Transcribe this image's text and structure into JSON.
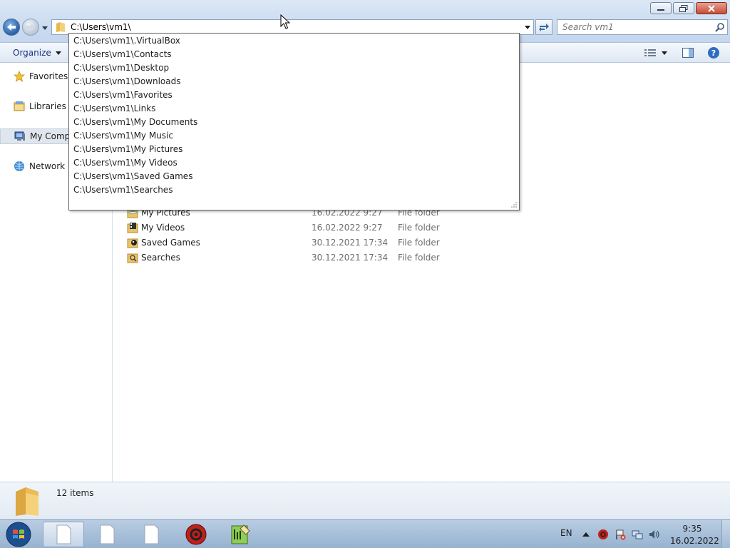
{
  "window": {
    "address": "C:\\Users\\vm1\\",
    "search_placeholder": "Search vm1"
  },
  "toolbar": {
    "organize_label": "Organize"
  },
  "navpane": {
    "items": [
      {
        "label": "Favorites",
        "icon": "star-icon"
      },
      {
        "label": "Libraries",
        "icon": "library-icon"
      },
      {
        "label": "My Computer",
        "icon": "computer-icon"
      },
      {
        "label": "Network",
        "icon": "network-icon"
      }
    ]
  },
  "autocomplete": {
    "items": [
      "C:\\Users\\vm1\\.VirtualBox",
      "C:\\Users\\vm1\\Contacts",
      "C:\\Users\\vm1\\Desktop",
      "C:\\Users\\vm1\\Downloads",
      "C:\\Users\\vm1\\Favorites",
      "C:\\Users\\vm1\\Links",
      "C:\\Users\\vm1\\My Documents",
      "C:\\Users\\vm1\\My Music",
      "C:\\Users\\vm1\\My Pictures",
      "C:\\Users\\vm1\\My Videos",
      "C:\\Users\\vm1\\Saved Games",
      "C:\\Users\\vm1\\Searches"
    ]
  },
  "files": [
    {
      "name": "My Pictures",
      "date": "16.02.2022 9:27",
      "type": "File folder",
      "icon": "pictures-folder-icon"
    },
    {
      "name": "My Videos",
      "date": "16.02.2022 9:27",
      "type": "File folder",
      "icon": "videos-folder-icon"
    },
    {
      "name": "Saved Games",
      "date": "30.12.2021 17:34",
      "type": "File folder",
      "icon": "saved-games-folder-icon"
    },
    {
      "name": "Searches",
      "date": "30.12.2021 17:34",
      "type": "File folder",
      "icon": "searches-folder-icon"
    }
  ],
  "details": {
    "item_count": "12 items"
  },
  "taskbar": {
    "language": "EN",
    "time": "9:35",
    "date": "16.02.2022"
  },
  "colors": {
    "accent": "#1e3287",
    "selection": "#dfe6ee",
    "close_button": "#c74c36"
  }
}
